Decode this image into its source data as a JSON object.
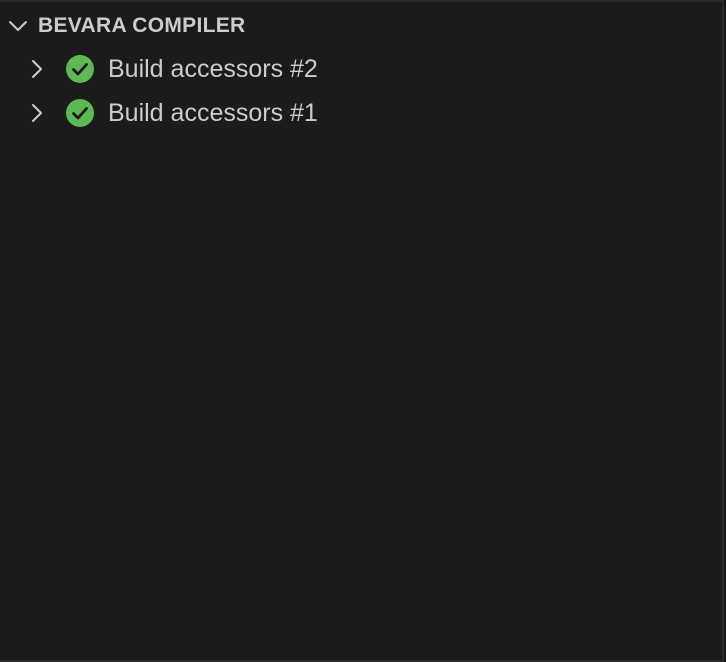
{
  "section": {
    "title": "BEVARA COMPILER",
    "expanded": true,
    "chevron_icon": "chevron-down-icon"
  },
  "items": [
    {
      "label": "Build accessors #2",
      "status": "success",
      "status_icon": "check-circle-icon",
      "chevron_icon": "chevron-right-icon"
    },
    {
      "label": "Build accessors #1",
      "status": "success",
      "status_icon": "check-circle-icon",
      "chevron_icon": "chevron-right-icon"
    }
  ],
  "colors": {
    "background": "#1b1b1b",
    "text": "#cccccc",
    "success": "#5fb856"
  }
}
